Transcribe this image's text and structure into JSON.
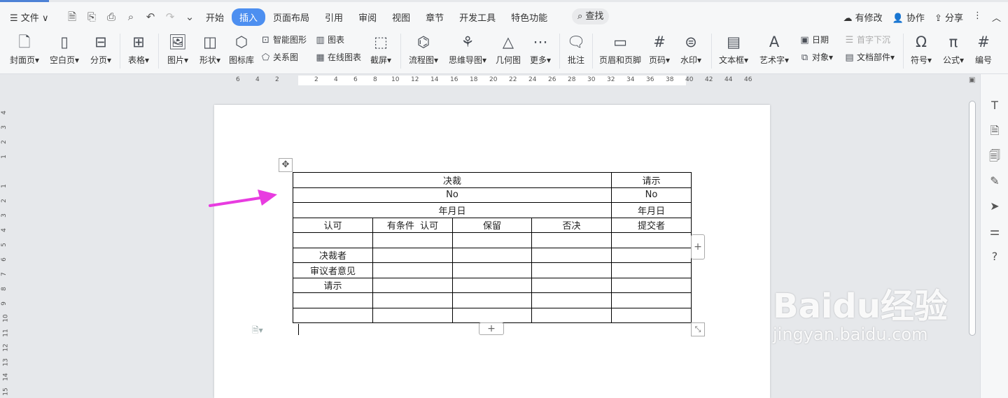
{
  "titlebar": {
    "file_menu": "文件"
  },
  "menu_tabs": [
    "开始",
    "插入",
    "页面布局",
    "引用",
    "审阅",
    "视图",
    "章节",
    "开发工具",
    "特色功能"
  ],
  "active_tab": "插入",
  "search_label": "查找",
  "top_right": [
    "有修改",
    "协作",
    "分享"
  ],
  "ribbon": {
    "large": [
      {
        "label": "封面页",
        "icon": "cover-page-icon"
      },
      {
        "label": "空白页",
        "icon": "blank-page-icon"
      },
      {
        "label": "分页",
        "icon": "page-break-icon"
      },
      {
        "label": "表格",
        "icon": "table-icon"
      },
      {
        "label": "图片",
        "icon": "picture-icon"
      },
      {
        "label": "形状",
        "icon": "shape-icon"
      },
      {
        "label": "图标库",
        "icon": "icon-library-icon"
      },
      {
        "label": "流程图",
        "icon": "flowchart-icon"
      },
      {
        "label": "思维导图",
        "icon": "mindmap-icon"
      },
      {
        "label": "几何图",
        "icon": "geometry-icon"
      },
      {
        "label": "更多",
        "icon": "more-icon"
      },
      {
        "label": "批注",
        "icon": "comment-icon"
      },
      {
        "label": "页眉和页脚",
        "icon": "header-footer-icon"
      },
      {
        "label": "页码",
        "icon": "page-number-icon"
      },
      {
        "label": "水印",
        "icon": "watermark-icon"
      },
      {
        "label": "文本框",
        "icon": "textbox-icon"
      },
      {
        "label": "艺术字",
        "icon": "wordart-icon"
      },
      {
        "label": "符号",
        "icon": "symbol-icon"
      },
      {
        "label": "公式",
        "icon": "formula-icon"
      },
      {
        "label": "编号",
        "icon": "numbering-icon"
      }
    ],
    "small": [
      {
        "label": "智能图形",
        "icon": "smartart-icon"
      },
      {
        "label": "关系图",
        "icon": "relation-chart-icon"
      },
      {
        "label": "图表",
        "icon": "chart-icon"
      },
      {
        "label": "在线图表",
        "icon": "online-chart-icon"
      },
      {
        "label": "截屏",
        "icon": "screenshot-icon"
      },
      {
        "label": "日期",
        "icon": "date-icon"
      },
      {
        "label": "对象",
        "icon": "object-icon"
      },
      {
        "label": "首字下沉",
        "icon": "drop-cap-icon"
      },
      {
        "label": "文档部件",
        "icon": "doc-parts-icon"
      }
    ]
  },
  "ruler_numbers": [
    "6",
    "4",
    "2",
    "2",
    "4",
    "6",
    "8",
    "10",
    "12",
    "14",
    "16",
    "18",
    "20",
    "22",
    "24",
    "26",
    "28",
    "30",
    "32",
    "34",
    "36",
    "38",
    "40",
    "42",
    "44",
    "46"
  ],
  "vruler_numbers": [
    "4",
    "3",
    "2",
    "1",
    "1",
    "2",
    "3",
    "4",
    "5",
    "6",
    "7",
    "8",
    "9",
    "10",
    "11",
    "12",
    "13",
    "14",
    "15"
  ],
  "table": {
    "rows": [
      {
        "left": "决裁",
        "right": "请示"
      },
      {
        "left": "No",
        "right": "No"
      },
      {
        "left": "年月日",
        "right": "年月日"
      }
    ],
    "header": [
      "认可",
      "有条件  认可",
      "保留",
      "否决",
      "提交者"
    ],
    "body_first_col": [
      "",
      "决裁者",
      "审议者意见",
      "请示",
      "",
      ""
    ]
  },
  "watermark": {
    "brand": "Baidu经验",
    "url": "jingyan.baidu.com"
  }
}
